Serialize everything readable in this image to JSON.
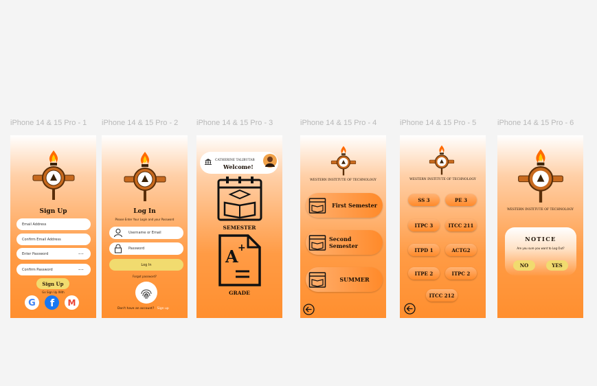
{
  "frames": [
    {
      "label": "iPhone 14 & 15 Pro - 1"
    },
    {
      "label": "iPhone 14 & 15 Pro - 2"
    },
    {
      "label": "iPhone 14 & 15 Pro - 3"
    },
    {
      "label": "iPhone 14 & 15 Pro - 4"
    },
    {
      "label": "iPhone 14 & 15 Pro - 5"
    },
    {
      "label": "iPhone 14 & 15 Pro - 6"
    }
  ],
  "signup": {
    "title": "Sign Up",
    "email": "Email Address",
    "confirm_email": "Confirm Email Address",
    "password": "Enter Password",
    "confirm_password": "Confirm Password",
    "button": "Sign Up",
    "social_label": "Go Sign Up With"
  },
  "login": {
    "title": "Log In",
    "subtitle": "Please Enter Your Login and your Password",
    "username": "Username or Email",
    "password": "Password",
    "button": "Log In",
    "forgot": "Forgot password?",
    "no_account": "Don't have an account?",
    "signup_link": "Sign up"
  },
  "home": {
    "user_name": "CATHERINE TALIBUTAB",
    "welcome": "Welcome!",
    "semester_label": "SEMESTER",
    "grade_label": "GRADE"
  },
  "institute": "WESTERN INSTITUTE OF TECHNOLOGY",
  "semesters": [
    "First Semester",
    "Second Semester",
    "SUMMER"
  ],
  "subjects": [
    "SS 3",
    "PE 3",
    "ITPC 3",
    "ITCC 211",
    "ITPD 1",
    "ACTG2",
    "ITPE 2",
    "ITPC 2",
    "ITCC 212"
  ],
  "notice": {
    "title": "NOTICE",
    "message": "Are you sure you want to Log Out?",
    "no": "NO",
    "yes": "YES"
  },
  "colors": {
    "orange": "#ff8f2f",
    "yellow_button": "#f1db6f",
    "background": "#f4f4f4"
  }
}
